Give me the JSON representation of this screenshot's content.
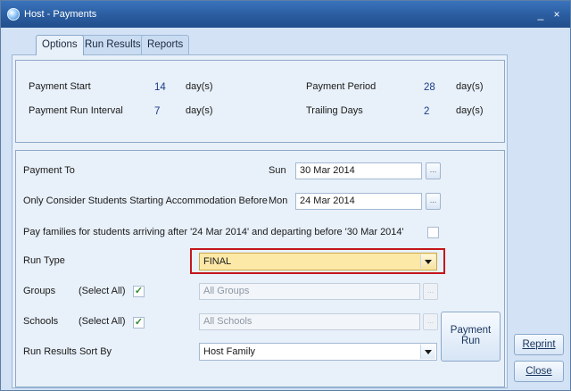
{
  "window": {
    "title": "Host - Payments",
    "minimize_glyph": "_",
    "close_glyph": "×"
  },
  "tabs": [
    {
      "label": "Options",
      "active": true
    },
    {
      "label": "Run Results",
      "active": false
    },
    {
      "label": "Reports",
      "active": false
    }
  ],
  "settings": {
    "payment_start": {
      "label": "Payment Start",
      "value": "14",
      "unit": "day(s)"
    },
    "payment_run_interval": {
      "label": "Payment Run Interval",
      "value": "7",
      "unit": "day(s)"
    },
    "payment_period": {
      "label": "Payment Period",
      "value": "28",
      "unit": "day(s)"
    },
    "trailing_days": {
      "label": "Trailing Days",
      "value": "2",
      "unit": "day(s)"
    }
  },
  "form": {
    "payment_to": {
      "label": "Payment To",
      "day": "Sun",
      "value": "30 Mar 2014",
      "button": "..."
    },
    "only_consider": {
      "label": "Only Consider Students Starting Accommodation Before",
      "day": "Mon",
      "value": "24 Mar 2014",
      "button": "..."
    },
    "pay_families": {
      "label": "Pay families for students arriving after '24 Mar 2014' and departing before '30 Mar 2014'",
      "checked": false
    },
    "run_type": {
      "label": "Run Type",
      "value": "FINAL"
    },
    "groups": {
      "label": "Groups",
      "select_all_label": "(Select All)",
      "select_all_checked": true,
      "value": "All Groups",
      "button": "..."
    },
    "schools": {
      "label": "Schools",
      "select_all_label": "(Select All)",
      "select_all_checked": true,
      "value": "All Schools",
      "button": "..."
    },
    "sort_by": {
      "label": "Run Results Sort By",
      "value": "Host Family"
    }
  },
  "buttons": {
    "payment_run": "Payment Run",
    "reprint": "Reprint",
    "close": "Close"
  },
  "colors": {
    "titlebar": "#2a5c9f",
    "highlight_field": "#fde9a7",
    "highlight_border": "#c4161c",
    "value_text": "#1a3a8a"
  }
}
